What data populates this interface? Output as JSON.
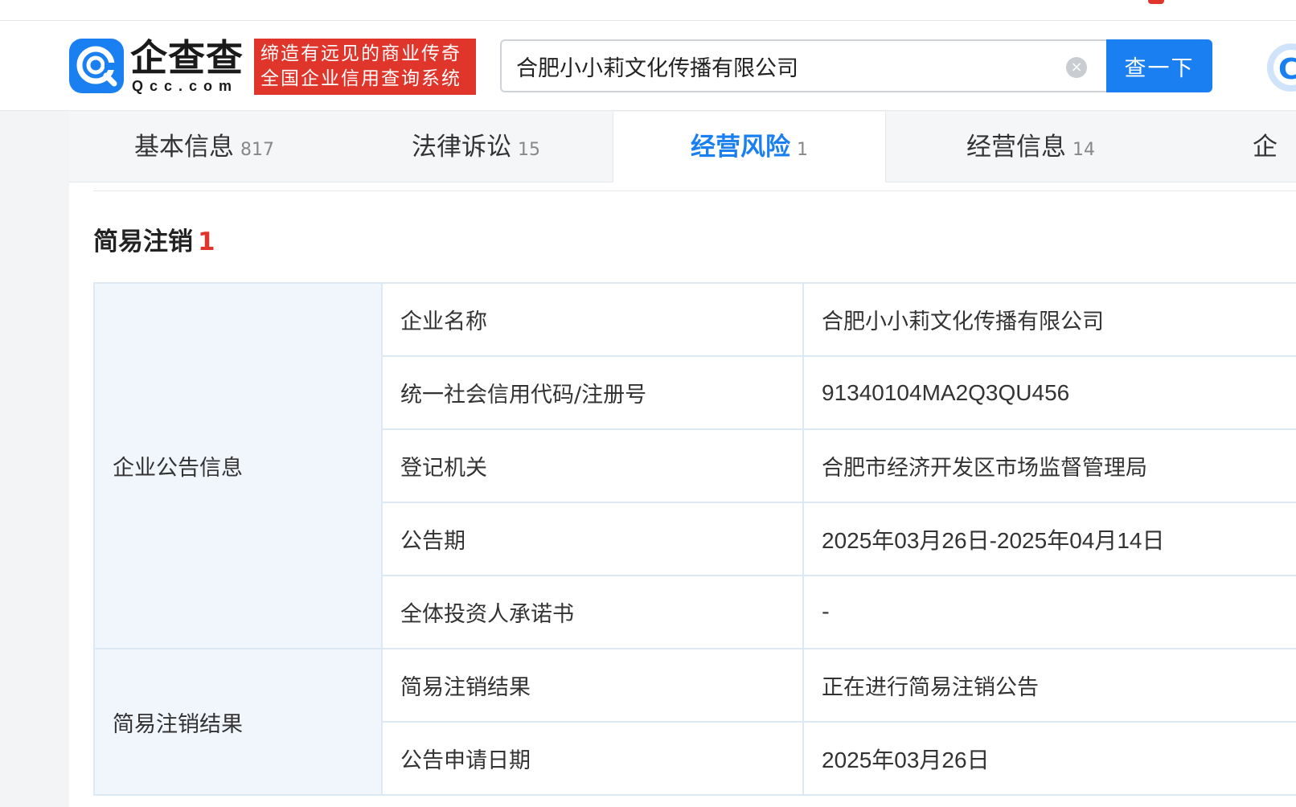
{
  "header": {
    "logo_cn": "企查查",
    "logo_en": "Qcc.com",
    "slogan_line1": "缔造有远见的商业传奇",
    "slogan_line2": "全国企业信用查询系统",
    "search_value": "合肥小小莉文化传播有限公司",
    "clear_icon": "×",
    "search_button": "查一下",
    "edge_logo_text": "C"
  },
  "tabs": [
    {
      "label": "基本信息",
      "count": "817"
    },
    {
      "label": "法律诉讼",
      "count": "15"
    },
    {
      "label": "经营风险",
      "count": "1"
    },
    {
      "label": "经营信息",
      "count": "14"
    },
    {
      "label": "企",
      "count": ""
    }
  ],
  "section": {
    "title": "简易注销",
    "count": "1"
  },
  "table": {
    "group1_label": "企业公告信息",
    "group2_label": "简易注销结果",
    "rows": [
      {
        "key": "企业名称",
        "value": "合肥小小莉文化传播有限公司"
      },
      {
        "key": "统一社会信用代码/注册号",
        "value": "91340104MA2Q3QU456"
      },
      {
        "key": "登记机关",
        "value": "合肥市经济开发区市场监督管理局"
      },
      {
        "key": "公告期",
        "value": "2025年03月26日-2025年04月14日"
      },
      {
        "key": "全体投资人承诺书",
        "value": "-"
      },
      {
        "key": "简易注销结果",
        "value": "正在进行简易注销公告"
      },
      {
        "key": "公告申请日期",
        "value": "2025年03月26日"
      }
    ]
  },
  "colors": {
    "brand_blue": "#1a7ff0",
    "brand_red": "#e0352b"
  },
  "icons": {
    "logo": "qcc-magnifier-logo-icon",
    "clear": "clear-circle-icon"
  }
}
